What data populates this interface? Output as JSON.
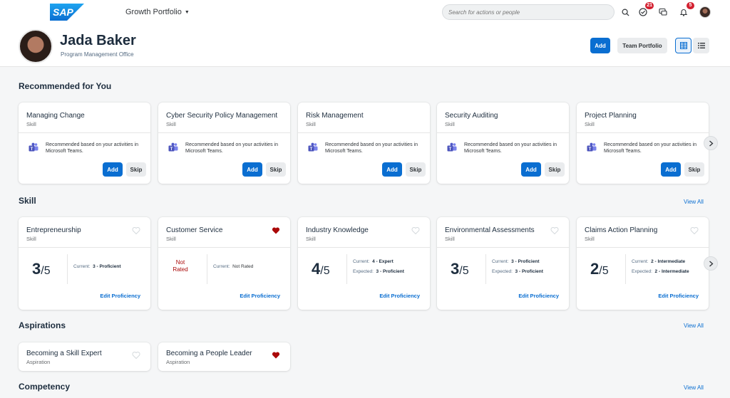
{
  "shell": {
    "brand": "SAP",
    "product": "Growth Portfolio",
    "search_placeholder": "Search for actions or people",
    "badges": {
      "tasks": "21",
      "notifications": "5"
    }
  },
  "header": {
    "name": "Jada Baker",
    "role": "Program Management Office",
    "add_label": "Add",
    "team_label": "Team Portfolio"
  },
  "recommended": {
    "title": "Recommended for You",
    "items": [
      {
        "title": "Managing Change",
        "type": "Skill",
        "text": "Recommended based on your activities in Microsoft Teams.",
        "add": "Add",
        "skip": "Skip"
      },
      {
        "title": "Cyber Security Policy Management",
        "type": "Skill",
        "text": "Recommended based on your activities in Microsoft Teams.",
        "add": "Add",
        "skip": "Skip"
      },
      {
        "title": "Risk Management",
        "type": "Skill",
        "text": "Recommended based on your activities in Microsoft Teams.",
        "add": "Add",
        "skip": "Skip"
      },
      {
        "title": "Security Auditing",
        "type": "Skill",
        "text": "Recommended based on your activities in Microsoft Teams.",
        "add": "Add",
        "skip": "Skip"
      },
      {
        "title": "Project Planning",
        "type": "Skill",
        "text": "Recommended based on your activities in Microsoft Teams.",
        "add": "Add",
        "skip": "Skip"
      }
    ]
  },
  "skill": {
    "title": "Skill",
    "view_all": "View All",
    "items": [
      {
        "title": "Entrepreneurship",
        "type": "Skill",
        "score": "3",
        "denominator": "/5",
        "current_label": "Current:",
        "current": "3 - Proficient",
        "expected_label": "",
        "expected": "",
        "edit": "Edit Proficiency",
        "favorite": false
      },
      {
        "title": "Customer Service",
        "type": "Skill",
        "not_rated": "Not Rated",
        "current_label": "Current:",
        "current": "Not Rated",
        "edit": "Edit Proficiency",
        "favorite": true
      },
      {
        "title": "Industry Knowledge",
        "type": "Skill",
        "score": "4",
        "denominator": "/5",
        "current_label": "Current:",
        "current": "4 - Expert",
        "expected_label": "Expected:",
        "expected": "3 - Proficient",
        "edit": "Edit Proficiency",
        "favorite": false
      },
      {
        "title": "Environmental Assessments",
        "type": "Skill",
        "score": "3",
        "denominator": "/5",
        "current_label": "Current:",
        "current": "3 - Proficient",
        "expected_label": "Expected:",
        "expected": "3 - Proficient",
        "edit": "Edit Proficiency",
        "favorite": false
      },
      {
        "title": "Claims Action Planning",
        "type": "Skill",
        "score": "2",
        "denominator": "/5",
        "current_label": "Current:",
        "current": "2 - Intermediate",
        "expected_label": "Expected:",
        "expected": "2 - Intermediate",
        "edit": "Edit Proficiency",
        "favorite": false
      }
    ]
  },
  "aspirations": {
    "title": "Aspirations",
    "view_all": "View All",
    "items": [
      {
        "title": "Becoming a Skill Expert",
        "type": "Aspiration",
        "favorite": false
      },
      {
        "title": "Becoming a People Leader",
        "type": "Aspiration",
        "favorite": true
      }
    ]
  },
  "competency": {
    "title": "Competency",
    "view_all": "View All"
  },
  "colors": {
    "accent": "#0a6ed1",
    "favorite": "#aa0808",
    "brand": "#0a6ed1"
  }
}
